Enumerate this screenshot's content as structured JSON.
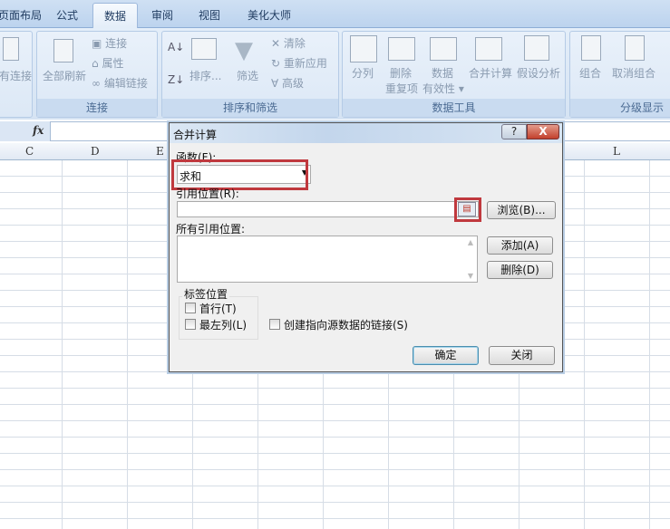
{
  "ribbon": {
    "tabs": [
      "页面布局",
      "公式",
      "数据",
      "审阅",
      "视图",
      "美化大师"
    ],
    "active_tab": "数据",
    "groups": {
      "existing": {
        "btn": "现有连接"
      },
      "connections": {
        "label": "连接",
        "refresh_all": "全部刷新",
        "connections": "连接",
        "properties": "属性",
        "edit_links": "编辑链接"
      },
      "sort_filter": {
        "label": "排序和筛选",
        "sort": "排序...",
        "filter": "筛选",
        "clear": "清除",
        "reapply": "重新应用",
        "advanced": "高级"
      },
      "data_tools": {
        "label": "数据工具",
        "text_to_columns": "分列",
        "remove_dup_1": "删除",
        "remove_dup_2": "重复项",
        "validation_1": "数据",
        "validation_2": "有效性",
        "consolidate": "合并计算",
        "what_if": "假设分析"
      },
      "outline": {
        "label": "分级显示",
        "group": "组合",
        "ungroup": "取消组合"
      }
    }
  },
  "formula_bar": {
    "fx": "fx",
    "value": ""
  },
  "columns": [
    "C",
    "D",
    "E",
    "L"
  ],
  "dialog": {
    "title": "合并计算",
    "help": "?",
    "close_x": "X",
    "function_label": "函数(F):",
    "function_value": "求和",
    "reference_label": "引用位置(R):",
    "reference_value": "",
    "browse": "浏览(B)...",
    "all_refs_label": "所有引用位置:",
    "add": "添加(A)",
    "delete": "删除(D)",
    "use_labels": "标签位置",
    "top_row": "首行(T)",
    "left_column": "最左列(L)",
    "create_links": "创建指向源数据的链接(S)",
    "ok": "确定",
    "close": "关闭"
  },
  "colors": {
    "highlight": "#c0393e",
    "ribbon": "#dce8f6"
  }
}
